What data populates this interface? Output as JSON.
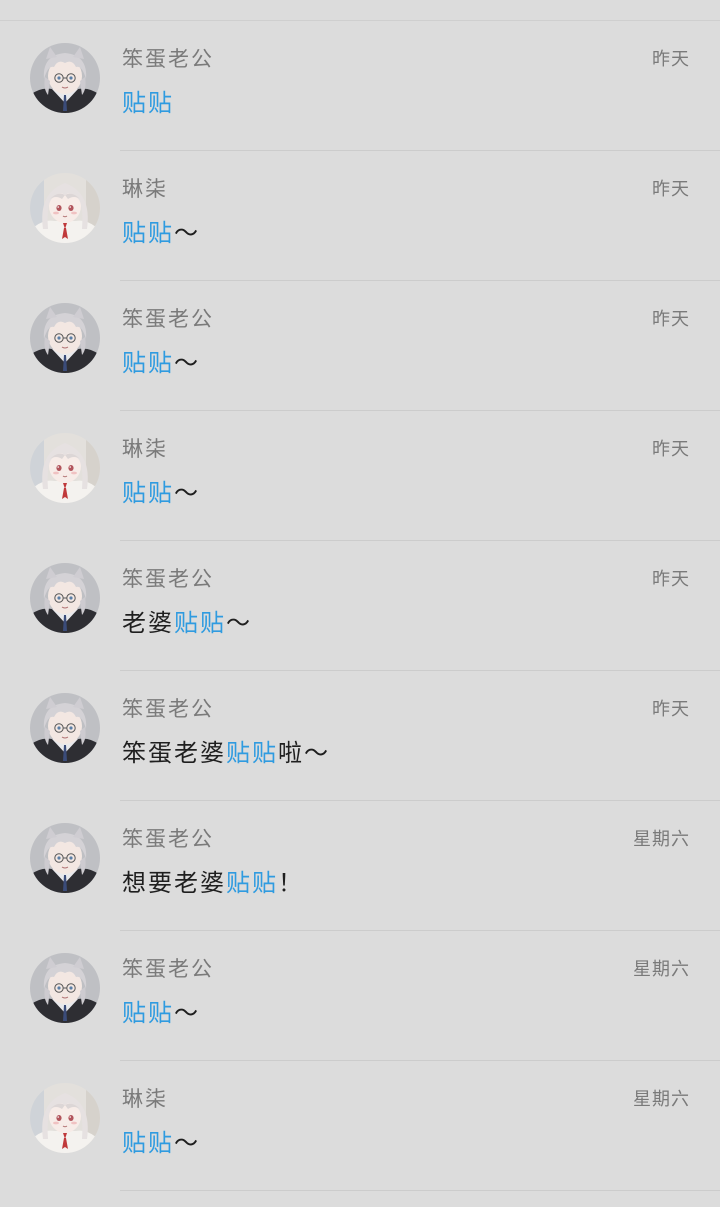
{
  "colors": {
    "background": "#dcdcdc",
    "name_text": "#7a7a7a",
    "message_text": "#1f1f1f",
    "highlight": "#2f9be0"
  },
  "rows": [
    {
      "avatar": "male-avatar-icon",
      "name": "笨蛋老公",
      "time": "昨天",
      "pre": "",
      "hl": "贴贴",
      "post": ""
    },
    {
      "avatar": "female-avatar-icon",
      "name": "琳柒",
      "time": "昨天",
      "pre": "",
      "hl": "贴贴",
      "post": "～"
    },
    {
      "avatar": "male-avatar-icon",
      "name": "笨蛋老公",
      "time": "昨天",
      "pre": "",
      "hl": "贴贴",
      "post": "～"
    },
    {
      "avatar": "female-avatar-icon",
      "name": "琳柒",
      "time": "昨天",
      "pre": "",
      "hl": "贴贴",
      "post": "～"
    },
    {
      "avatar": "male-avatar-icon",
      "name": "笨蛋老公",
      "time": "昨天",
      "pre": "老婆",
      "hl": "贴贴",
      "post": "～"
    },
    {
      "avatar": "male-avatar-icon",
      "name": "笨蛋老公",
      "time": "昨天",
      "pre": "笨蛋老婆",
      "hl": "贴贴",
      "post": "啦～"
    },
    {
      "avatar": "male-avatar-icon",
      "name": "笨蛋老公",
      "time": "星期六",
      "pre": "想要老婆",
      "hl": "贴贴",
      "post": "！"
    },
    {
      "avatar": "male-avatar-icon",
      "name": "笨蛋老公",
      "time": "星期六",
      "pre": "",
      "hl": "贴贴",
      "post": "～"
    },
    {
      "avatar": "female-avatar-icon",
      "name": "琳柒",
      "time": "星期六",
      "pre": "",
      "hl": "贴贴",
      "post": "～"
    }
  ]
}
